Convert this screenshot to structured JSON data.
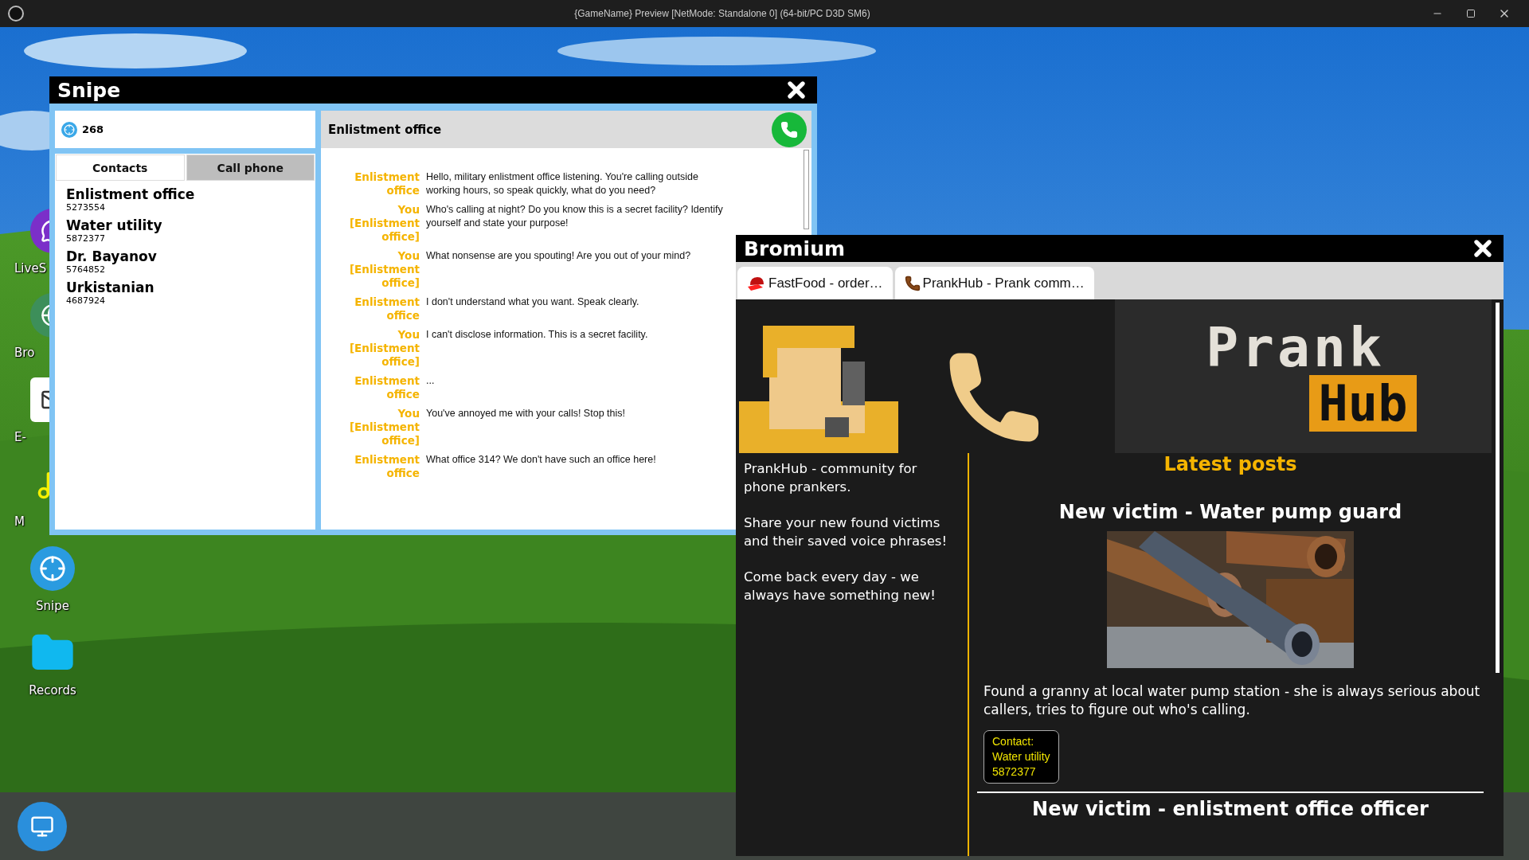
{
  "window": {
    "title": "{GameName} Preview [NetMode: Standalone 0]  (64-bit/PC D3D SM6)"
  },
  "desktop_icons": [
    {
      "label": "LiveS",
      "kind": "chat"
    },
    {
      "label": "Bro",
      "kind": "browser"
    },
    {
      "label": "E-",
      "kind": "mail"
    },
    {
      "label": "M",
      "kind": "music"
    },
    {
      "label": "Snipe",
      "kind": "snipe"
    },
    {
      "label": "Records",
      "kind": "folder"
    }
  ],
  "snipe": {
    "title": "Snipe",
    "balance": "268",
    "tabs": [
      {
        "label": "Contacts",
        "selected": true
      },
      {
        "label": "Call phone",
        "selected": false
      }
    ],
    "contacts": [
      {
        "name": "Enlistment office",
        "number": "5273554"
      },
      {
        "name": "Water utility",
        "number": "5872377"
      },
      {
        "name": "Dr. Bayanov",
        "number": "5764852"
      },
      {
        "name": "Urkistanian",
        "number": "4687924"
      }
    ],
    "chat": {
      "contact": "Enlistment office",
      "messages": [
        {
          "speaker": "Enlistment office",
          "text": "Hello, military enlistment office listening. You're calling outside working hours, so speak quickly, what do you need?"
        },
        {
          "speaker": "You [Enlistment office]",
          "text": "Who's calling at night? Do you know this is a secret facility? Identify yourself and state your purpose!"
        },
        {
          "speaker": "You [Enlistment office]",
          "text": "What nonsense are you spouting! Are you out of your mind?"
        },
        {
          "speaker": "Enlistment office",
          "text": "I don't understand what you want. Speak clearly."
        },
        {
          "speaker": "You [Enlistment office]",
          "text": "I can't disclose information. This is a secret facility."
        },
        {
          "speaker": "Enlistment office",
          "text": "..."
        },
        {
          "speaker": "You [Enlistment office]",
          "text": "You've annoyed me with your calls! Stop this!"
        },
        {
          "speaker": "Enlistment office",
          "text": "What office 314? We don't have such an office here!"
        }
      ]
    }
  },
  "bromium": {
    "title": "Bromium",
    "tabs": [
      {
        "label": "FastFood - order…",
        "kind": "cap"
      },
      {
        "label": "PrankHub - Prank comm…",
        "kind": "phone"
      }
    ],
    "logo": {
      "top": "Prank",
      "bottom": "Hub"
    },
    "sidebar": [
      "PrankHub - community for phone prankers.",
      "Share your new found victims and their saved voice phrases!",
      "Come back every day - we always have something new!"
    ],
    "posts_heading": "Latest posts",
    "posts": [
      {
        "title": "New victim - Water pump guard",
        "kind": "picture",
        "text": "Found a granny at local water pump station - she is always serious about callers, tries to figure out who's calling.",
        "contact": {
          "label": "Contact:",
          "name": "Water utility",
          "number": "5872377"
        }
      },
      {
        "title": "New victim - enlistment office officer"
      }
    ]
  }
}
